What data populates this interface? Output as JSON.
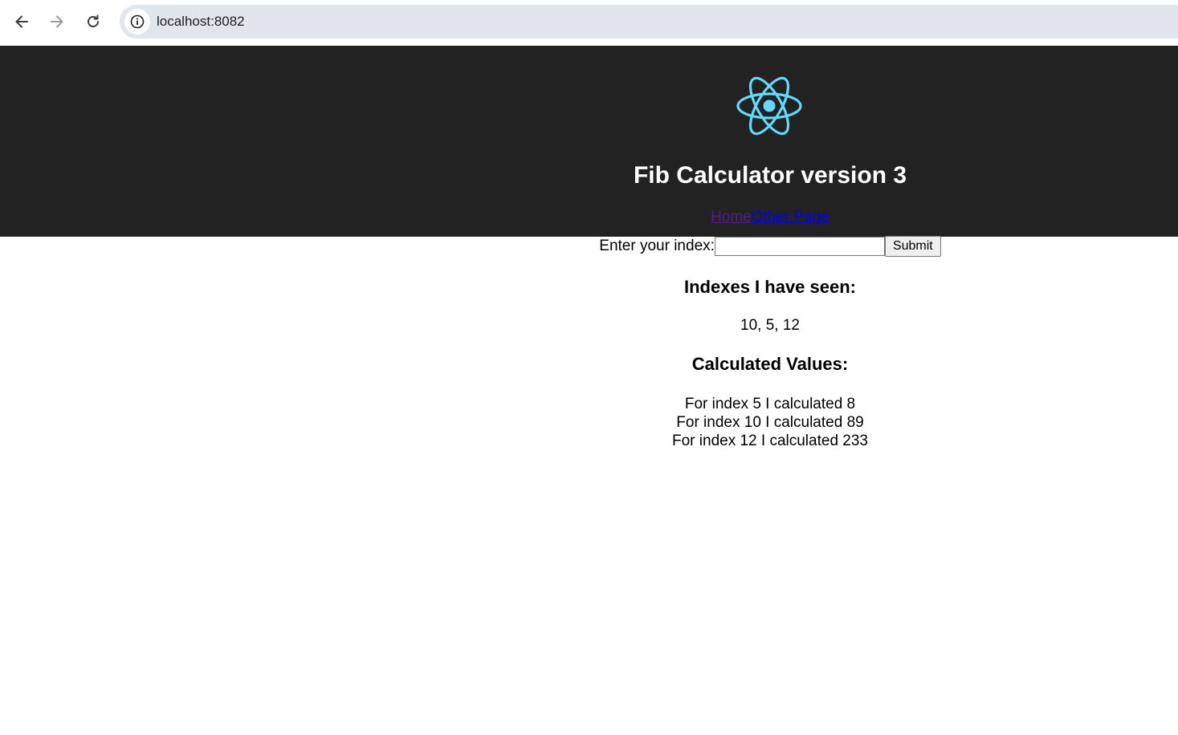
{
  "browser": {
    "url": "localhost:8082",
    "icons": {
      "back": "arrow-left-icon",
      "forward": "arrow-right-icon",
      "reload": "reload-icon",
      "site_info": "info-icon"
    }
  },
  "header": {
    "logo": "react-logo-icon",
    "logo_color": "#61dafb",
    "background_color": "#222222",
    "title": "Fib Calculator version 3",
    "links": {
      "home": "Home",
      "other_page": "Other Page"
    }
  },
  "form": {
    "label": "Enter your index:",
    "input_value": "",
    "submit_label": "Submit"
  },
  "indexes_section": {
    "title": "Indexes I have seen:",
    "values": "10, 5, 12"
  },
  "calculated_section": {
    "title": "Calculated Values:",
    "items": [
      "For index 5 I calculated 8",
      "For index 10 I calculated 89",
      "For index 12 I calculated 233"
    ]
  }
}
